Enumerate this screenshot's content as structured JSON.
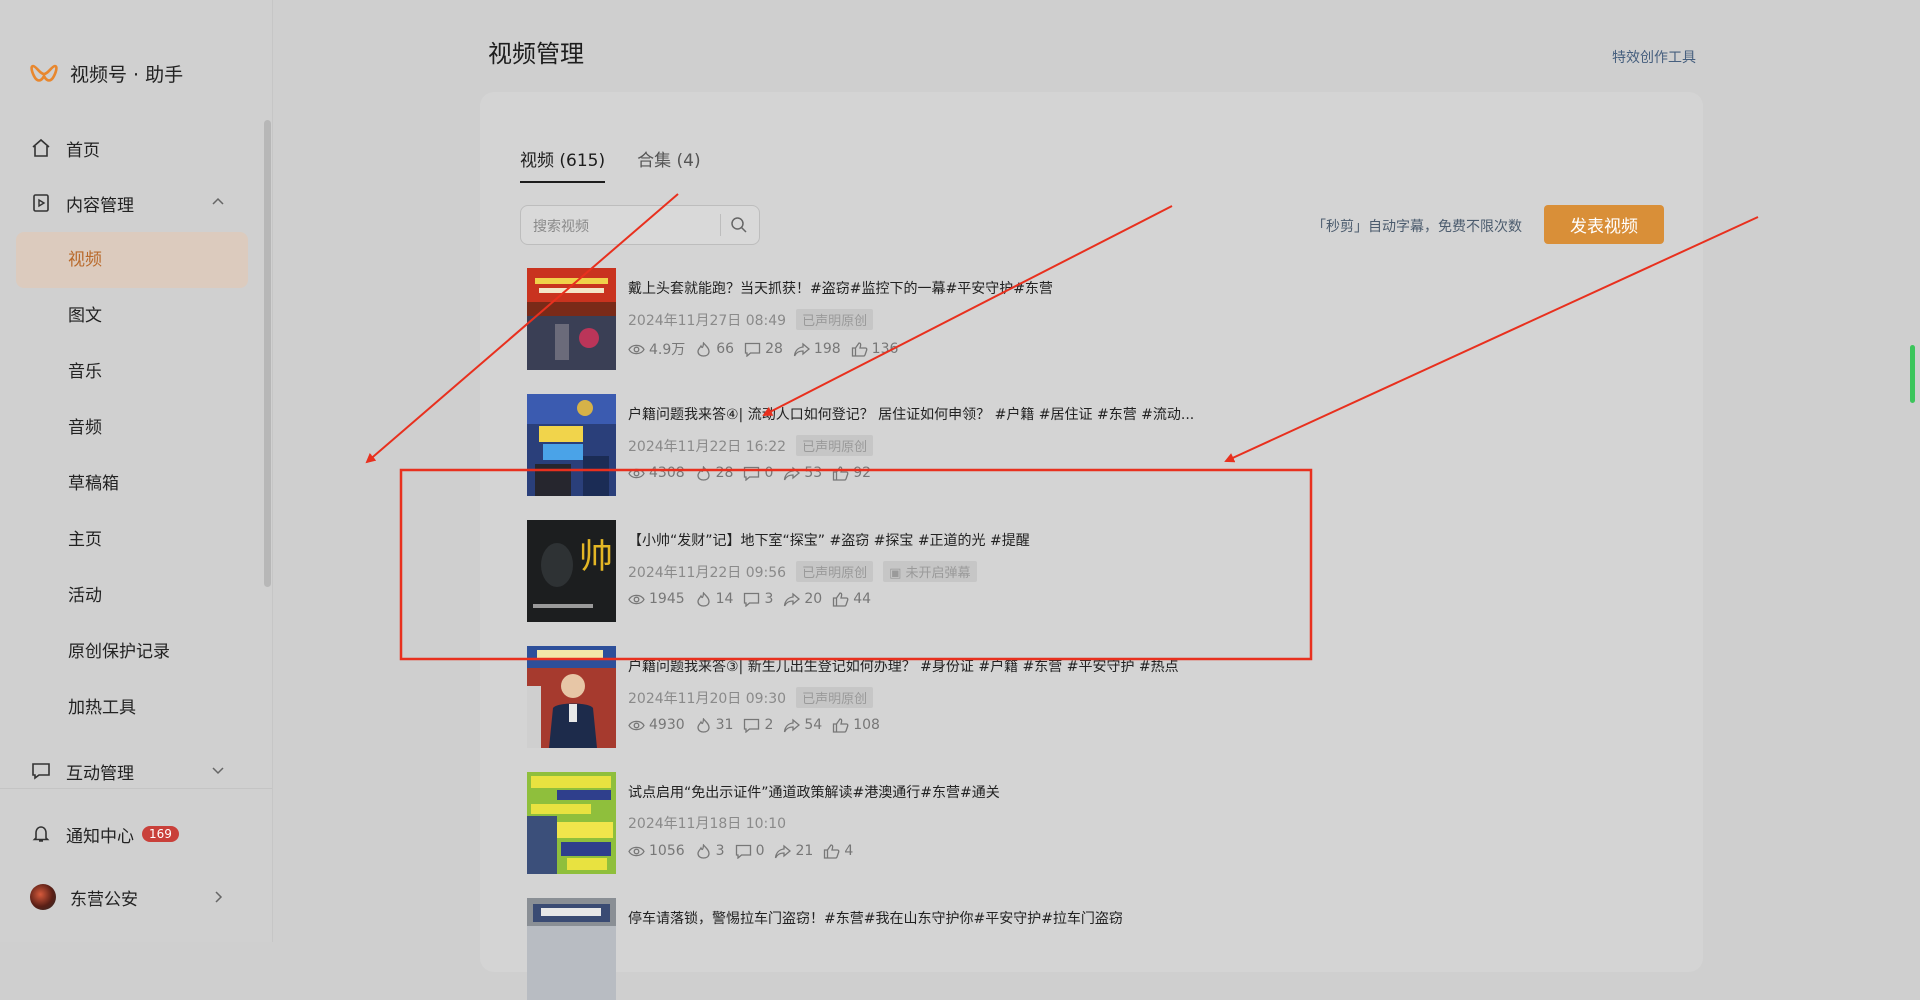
{
  "app": {
    "name": "视频号 · 助手",
    "brand_color": "#e8872e"
  },
  "sidebar": {
    "home": "首页",
    "content_mgmt": "内容管理",
    "sub_items": [
      "视频",
      "图文",
      "音乐",
      "音频",
      "草稿箱",
      "主页",
      "活动",
      "原创保护记录",
      "加热工具"
    ],
    "active_item": "视频",
    "interaction_mgmt": "互动管理",
    "notification": "通知中心",
    "notification_count": "169",
    "account_name": "东营公安"
  },
  "main": {
    "title": "视频管理",
    "top_link": "特效创作工具",
    "tabs": [
      "视频 (615)",
      "合集 (4)"
    ],
    "search_placeholder": "搜索视频",
    "hint": "「秒剪」自动字幕，免费不限次数",
    "publish_button": "发表视频",
    "videos": [
      {
        "title": "戴上头套就能跑？当天抓获！#盗窃#监控下的一幕#平安守护#东营",
        "date": "2024年11月27日 08:49",
        "tags": [
          "已声明原创"
        ],
        "views": "4.9万",
        "heat": "66",
        "comments": "28",
        "shares": "198",
        "likes": "136",
        "thumb_icon": "police-video-thumbnail"
      },
      {
        "title": "户籍问题我来答④| 流动人口如何登记？ 居住证如何申领？ #户籍 #居住证 #东营 #流动...",
        "date": "2024年11月22日 16:22",
        "tags": [
          "已声明原创"
        ],
        "views": "4308",
        "heat": "28",
        "comments": "0",
        "shares": "53",
        "likes": "92",
        "thumb_icon": "huji-wenda-thumbnail"
      },
      {
        "title": "【小帅“发财”记】地下室“探宝” #盗窃 #探宝 #正道的光 #提醒",
        "date": "2024年11月22日 09:56",
        "tags": [
          "已声明原创",
          "未开启弹幕"
        ],
        "views": "1945",
        "heat": "14",
        "comments": "3",
        "shares": "20",
        "likes": "44",
        "thumb_text": "帅"
      },
      {
        "title": "户籍问题我来答③| 新生儿出生登记如何办理？ #身份证 #户籍 #东营 #平安守护 #热点",
        "date": "2024年11月20日 09:30",
        "tags": [
          "已声明原创"
        ],
        "views": "4930",
        "heat": "31",
        "comments": "2",
        "shares": "54",
        "likes": "108",
        "thumb_icon": "officer-thumbnail"
      },
      {
        "title": "试点启用“免出示证件”通道政策解读#港澳通行#东营#通关",
        "date": "2024年11月18日 10:10",
        "tags": [],
        "views": "1056",
        "heat": "3",
        "comments": "0",
        "shares": "21",
        "likes": "4",
        "thumb_icon": "policy-thumbnail"
      },
      {
        "title": "停车请落锁，警惕拉车门盗窃！#东营#我在山东守护你#平安守护#拉车门盗窃",
        "date": "",
        "tags": [],
        "thumb_icon": "parking-thumbnail"
      }
    ]
  },
  "annotations": {
    "color": "#e8301e",
    "highlighted_video_index": 2
  }
}
